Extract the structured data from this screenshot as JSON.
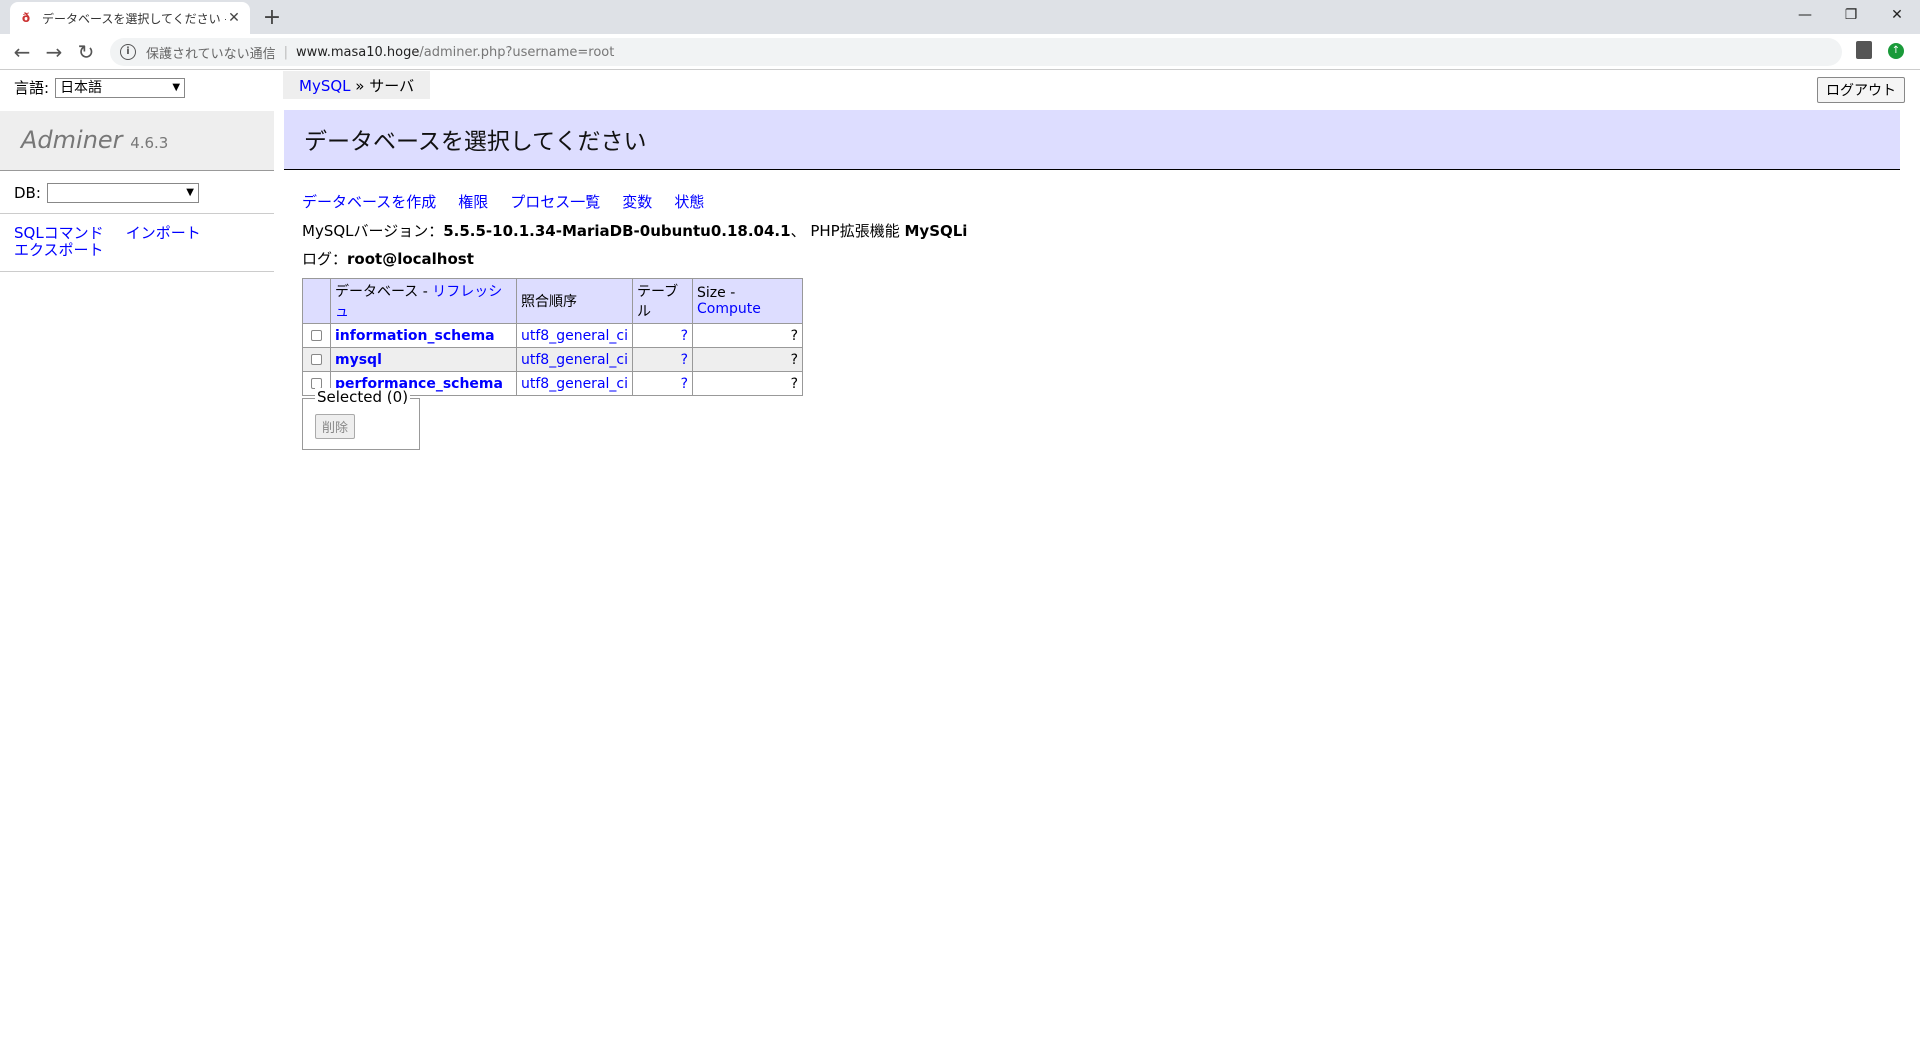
{
  "browser": {
    "tab_title": "データベースを選択してください - Adminer",
    "favicon": "adminer-icon",
    "new_tab": "+",
    "url_secure_label": "保護されていない通信",
    "url_host": "www.masa10.hoge",
    "url_path": "/adminer.php?username=root"
  },
  "sidebar": {
    "lang_label": "言語:",
    "lang_value": "日本語",
    "logo": "Adminer",
    "version": "4.6.3",
    "db_label": "DB:",
    "db_value": "",
    "links": [
      "SQLコマンド",
      "インポート",
      "エクスポート"
    ]
  },
  "main": {
    "breadcrumb_link": "MySQL",
    "breadcrumb_sep": "»",
    "breadcrumb_current": "サーバ",
    "logout_label": "ログアウト",
    "title": "データベースを選択してください",
    "actions": [
      "データベースを作成",
      "権限",
      "プロセス一覧",
      "変数",
      "状態"
    ],
    "version_label": "MySQLバージョン：",
    "version_value": "5.5.5-10.1.34-MariaDB-0ubuntu0.18.04.1",
    "ext_label": "、 PHP拡張機能",
    "ext_value": "MySQLi",
    "login_label": "ログ：",
    "login_value": "root@localhost",
    "table": {
      "headers": {
        "database": "データベース",
        "refresh": "リフレッシュ",
        "collation": "照合順序",
        "tables": "テーブル",
        "size": "Size",
        "compute": "Compute"
      },
      "rows": [
        {
          "name": "information_schema",
          "collation": "utf8_general_ci",
          "tables": "?",
          "size": "?"
        },
        {
          "name": "mysql",
          "collation": "utf8_general_ci",
          "tables": "?",
          "size": "?"
        },
        {
          "name": "performance_schema",
          "collation": "utf8_general_ci",
          "tables": "?",
          "size": "?"
        }
      ]
    },
    "selected_legend": "Selected (0)",
    "delete_label": "削除"
  }
}
